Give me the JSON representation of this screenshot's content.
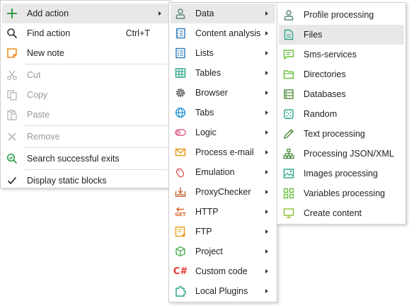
{
  "menu1": {
    "items": [
      {
        "label": "Add action",
        "icon": "plus-icon",
        "submenu": true,
        "highlighted": true
      },
      {
        "label": "Find action",
        "shortcut": "Ctrl+T",
        "icon": "search-icon"
      },
      {
        "label": "New note",
        "icon": "note-icon"
      },
      {
        "label": "Cut",
        "icon": "scissors-icon",
        "disabled": true
      },
      {
        "label": "Copy",
        "icon": "copy-icon",
        "disabled": true
      },
      {
        "label": "Paste",
        "icon": "paste-icon",
        "disabled": true
      },
      {
        "label": "Remove",
        "icon": "x-icon",
        "disabled": true
      },
      {
        "label": "Search successful exits",
        "icon": "search-check-icon"
      },
      {
        "label": "Display static blocks",
        "icon": "checkmark-icon"
      }
    ]
  },
  "menu2": {
    "items": [
      {
        "label": "Data",
        "icon": "person-icon",
        "highlighted": true
      },
      {
        "label": "Content analysis",
        "icon": "document-icon"
      },
      {
        "label": "Lists",
        "icon": "list-icon"
      },
      {
        "label": "Tables",
        "icon": "table-icon"
      },
      {
        "label": "Browser",
        "icon": "gear-icon"
      },
      {
        "label": "Tabs",
        "icon": "globe-icon"
      },
      {
        "label": "Logic",
        "icon": "toggle-icon"
      },
      {
        "label": "Process e-mail",
        "icon": "envelope-icon"
      },
      {
        "label": "Emulation",
        "icon": "mouse-icon"
      },
      {
        "label": "ProxyChecker",
        "icon": "download-box-icon"
      },
      {
        "label": "HTTP",
        "icon": "get-request-icon",
        "icon_text": "GET"
      },
      {
        "label": "FTP",
        "icon": "ftp-icon"
      },
      {
        "label": "Project",
        "icon": "cube-icon"
      },
      {
        "label": "Custom code",
        "icon": "csharp-icon",
        "icon_text": "C#"
      },
      {
        "label": "Local Plugins",
        "icon": "puzzle-icon"
      }
    ]
  },
  "menu3": {
    "items": [
      {
        "label": "Profile processing",
        "icon": "profile-icon"
      },
      {
        "label": "Files",
        "icon": "file-icon",
        "highlighted": true
      },
      {
        "label": "Sms-services",
        "icon": "chat-icon"
      },
      {
        "label": "Directories",
        "icon": "folder-icon"
      },
      {
        "label": "Databases",
        "icon": "database-icon"
      },
      {
        "label": "Random",
        "icon": "dice-icon"
      },
      {
        "label": "Text processing",
        "icon": "pencil-icon"
      },
      {
        "label": "Processing JSON/XML",
        "icon": "hierarchy-icon"
      },
      {
        "label": "Images processing",
        "icon": "image-icon"
      },
      {
        "label": "Variables processing",
        "icon": "grid-icon"
      },
      {
        "label": "Create content",
        "icon": "monitor-icon"
      }
    ]
  },
  "colors": {
    "accent_green": "#4caf50",
    "highlight": "#e8e8e8",
    "note_orange": "#f08c1e",
    "csharp_red": "#e53935",
    "logic_pink": "#e05a8a"
  }
}
